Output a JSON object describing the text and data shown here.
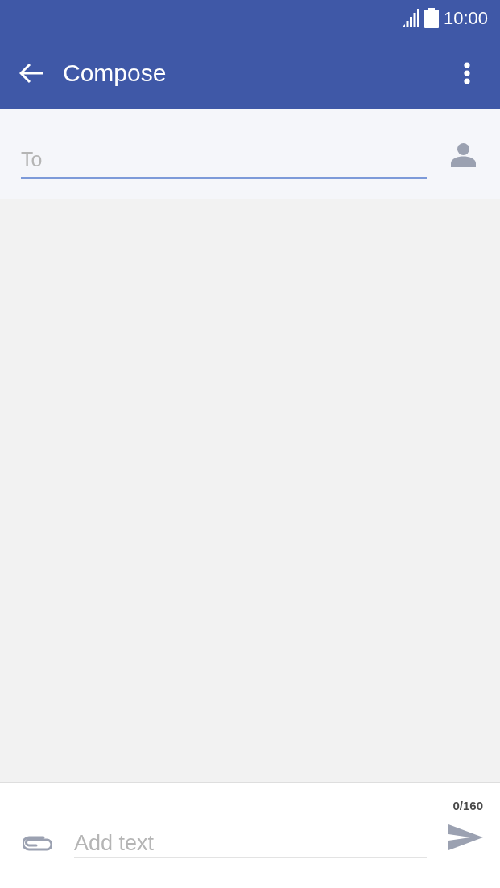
{
  "status_bar": {
    "time": "10:00"
  },
  "app_bar": {
    "title": "Compose"
  },
  "recipient": {
    "placeholder": "To"
  },
  "composer": {
    "counter": "0/160",
    "message": {
      "placeholder": "Add text"
    }
  }
}
